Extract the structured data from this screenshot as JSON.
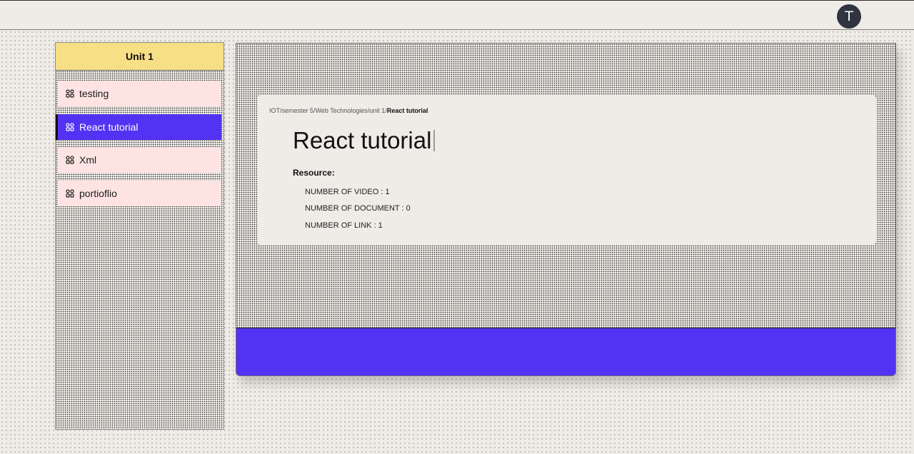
{
  "header": {
    "avatar_letter": "T"
  },
  "sidebar": {
    "title": "Unit 1",
    "items": [
      {
        "label": "testing",
        "icon": "grid-icon",
        "active": false
      },
      {
        "label": "React tutorial",
        "icon": "grid-icon",
        "active": true
      },
      {
        "label": "Xml",
        "icon": "grid-icon",
        "active": false
      },
      {
        "label": "portioflio",
        "icon": "grid-icon",
        "active": false
      }
    ]
  },
  "content": {
    "breadcrumb": {
      "segments": [
        "IOT",
        "semester 5",
        "Web Technologies",
        "unit 1"
      ],
      "separator": "/",
      "current": "React tutorial"
    },
    "title": "React tutorial",
    "resource_label": "Resource:",
    "resources": [
      "NUMBER OF VIDEO : 1",
      "NUMBER OF DOCUMENT : 0",
      "NUMBER OF LINK : 1"
    ]
  },
  "colors": {
    "accent": "#5233f3",
    "header_yellow": "#f7df86",
    "item_pink": "#fde4e2",
    "background": "#efebe6",
    "avatar": "#2f3440"
  }
}
